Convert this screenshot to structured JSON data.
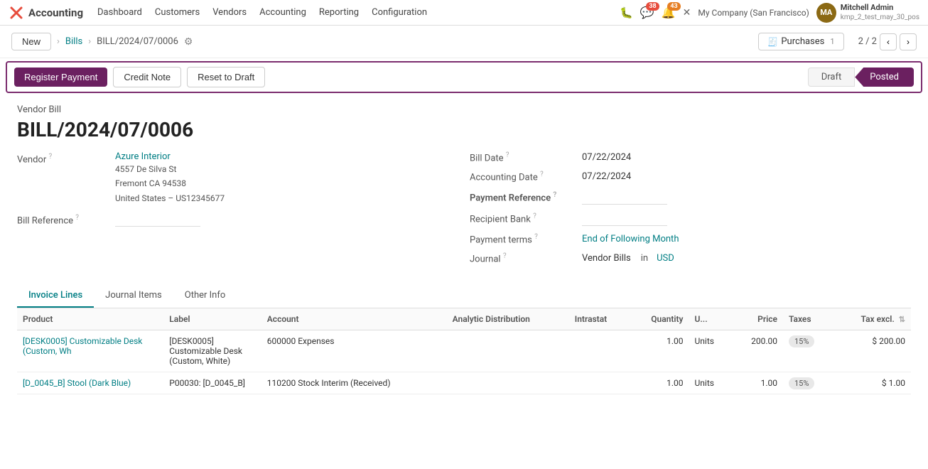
{
  "brand": {
    "icon_text": "✕",
    "name": "Accounting"
  },
  "nav": {
    "items": [
      "Dashboard",
      "Customers",
      "Vendors",
      "Accounting",
      "Reporting",
      "Configuration"
    ]
  },
  "nav_right": {
    "bug_label": "🐛",
    "msg_count": "38",
    "notif_count": "43",
    "cross_label": "✕",
    "company": "My Company (San Francisco)",
    "user_name": "Mitchell Admin",
    "user_sub": "kmp_2_test_may_30_pos",
    "user_initials": "MA"
  },
  "breadcrumb": {
    "new_label": "New",
    "parent_label": "Bills",
    "current_label": "BILL/2024/07/0006",
    "purchases_label": "Purchases",
    "purchases_count": "1",
    "page_info": "2 / 2"
  },
  "actions": {
    "register_payment": "Register Payment",
    "credit_note": "Credit Note",
    "reset_to_draft": "Reset to Draft",
    "status_draft": "Draft",
    "status_posted": "Posted"
  },
  "document": {
    "doc_type": "Vendor Bill",
    "doc_number": "BILL/2024/07/0006",
    "vendor_label": "Vendor",
    "vendor_name": "Azure Interior",
    "vendor_address_line1": "4557 De Silva St",
    "vendor_address_line2": "Fremont CA 94538",
    "vendor_address_line3": "United States – US12345677",
    "bill_ref_label": "Bill Reference",
    "bill_date_label": "Bill Date",
    "bill_date_value": "07/22/2024",
    "accounting_date_label": "Accounting Date",
    "accounting_date_value": "07/22/2024",
    "payment_ref_label": "Payment Reference",
    "recipient_bank_label": "Recipient Bank",
    "payment_terms_label": "Payment terms",
    "payment_terms_value": "End of Following Month",
    "journal_label": "Journal",
    "journal_value": "Vendor Bills",
    "journal_in": "in",
    "journal_currency": "USD"
  },
  "tabs": {
    "items": [
      "Invoice Lines",
      "Journal Items",
      "Other Info"
    ],
    "active": "Invoice Lines"
  },
  "table": {
    "columns": [
      "Product",
      "Label",
      "Account",
      "Analytic Distribution",
      "Intrastat",
      "Quantity",
      "U...",
      "Price",
      "Taxes",
      "Tax excl."
    ],
    "rows": [
      {
        "product": "[DESK0005] Customizable Desk (Custom, Wh",
        "label": "[DESK0005] Customizable Desk (Custom, White)",
        "account": "600000 Expenses",
        "analytic": "",
        "intrastat": "",
        "quantity": "1.00",
        "unit": "Units",
        "price": "200.00",
        "taxes": "15%",
        "tax_excl": "$ 200.00"
      },
      {
        "product": "[D_0045_B] Stool (Dark Blue)",
        "label": "P00030: [D_0045_B]",
        "account": "110200 Stock Interim (Received)",
        "analytic": "",
        "intrastat": "",
        "quantity": "1.00",
        "unit": "Units",
        "price": "1.00",
        "taxes": "15%",
        "tax_excl": "$ 1.00"
      }
    ]
  }
}
